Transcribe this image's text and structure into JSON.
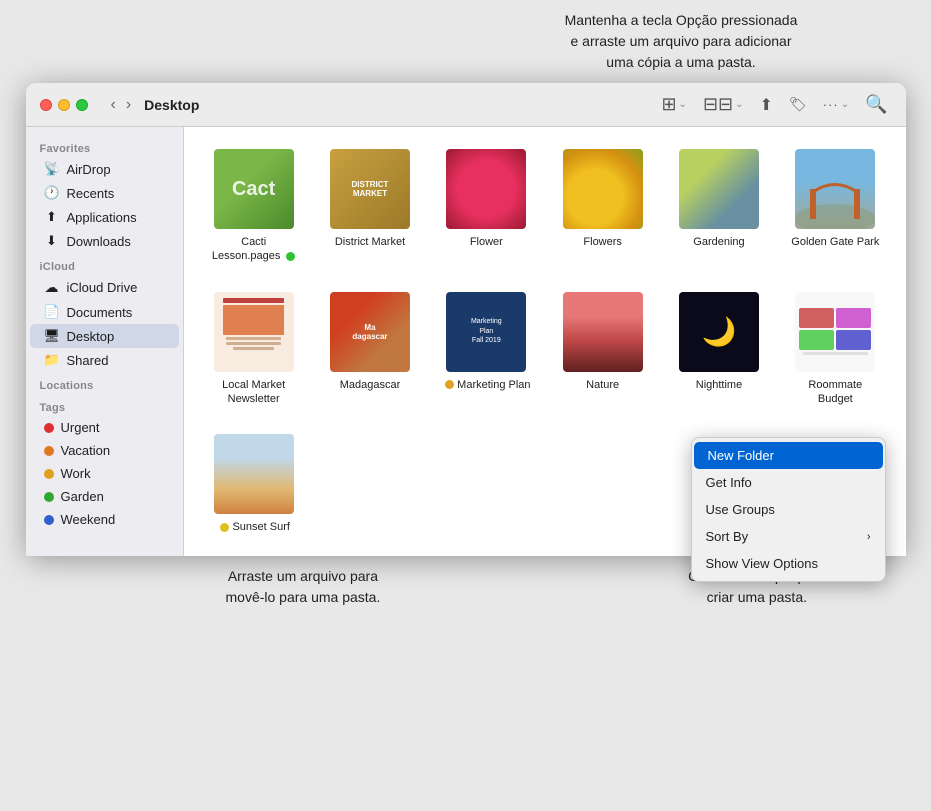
{
  "tooltip_top": "Mantenha a tecla Opção pressionada\ne arraste um arquivo para adicionar\numa cópia a uma pasta.",
  "window": {
    "title": "Desktop"
  },
  "toolbar": {
    "back": "‹",
    "forward": "›",
    "view_icon": "⊞",
    "group_icon": "⊟",
    "share_icon": "↑",
    "tag_icon": "🏷",
    "more_icon": "···",
    "search_icon": "🔍"
  },
  "sidebar": {
    "favorites": [
      {
        "id": "airdrop",
        "icon": "📡",
        "label": "AirDrop"
      },
      {
        "id": "recents",
        "icon": "🕐",
        "label": "Recents"
      },
      {
        "id": "applications",
        "icon": "⬆",
        "label": "Applications"
      },
      {
        "id": "downloads",
        "icon": "⬇",
        "label": "Downloads"
      }
    ],
    "icloud_label": "iCloud",
    "icloud": [
      {
        "id": "icloud-drive",
        "icon": "☁",
        "label": "iCloud Drive"
      },
      {
        "id": "documents",
        "icon": "📄",
        "label": "Documents"
      },
      {
        "id": "desktop",
        "icon": "🖥",
        "label": "Desktop",
        "active": true
      },
      {
        "id": "shared",
        "icon": "📁",
        "label": "Shared"
      }
    ],
    "locations_label": "Locations",
    "locations": [],
    "tags_label": "Tags",
    "tags": [
      {
        "id": "urgent",
        "color": "#e03030",
        "label": "Urgent"
      },
      {
        "id": "vacation",
        "color": "#e07820",
        "label": "Vacation"
      },
      {
        "id": "work",
        "color": "#e0a020",
        "label": "Work"
      },
      {
        "id": "garden",
        "color": "#30a830",
        "label": "Garden"
      },
      {
        "id": "weekend",
        "color": "#3060d0",
        "label": "Weekend"
      }
    ]
  },
  "files": [
    {
      "id": "cacti",
      "name": "Cacti\nLesson.pages",
      "thumb": "cacti",
      "badge": "#30c030",
      "badge_visible": true
    },
    {
      "id": "district",
      "name": "District Market",
      "thumb": "district",
      "badge": null
    },
    {
      "id": "flower",
      "name": "Flower",
      "thumb": "flower",
      "badge": null
    },
    {
      "id": "flowers",
      "name": "Flowers",
      "thumb": "flowers",
      "badge": null
    },
    {
      "id": "gardening",
      "name": "Gardening",
      "thumb": "gardening",
      "badge": null
    },
    {
      "id": "goldengate",
      "name": "Golden Gate Park",
      "thumb": "goldengate",
      "badge": null
    },
    {
      "id": "newsletter",
      "name": "Local Market\nNewsletter",
      "thumb": "newsletter",
      "badge": null
    },
    {
      "id": "madagascar",
      "name": "Madagascar",
      "thumb": "madagascar",
      "badge": null
    },
    {
      "id": "marketing",
      "name": "Marketing Plan",
      "thumb": "marketing",
      "badge": "#e0a020",
      "badge_visible": true
    },
    {
      "id": "nature",
      "name": "Nature",
      "thumb": "nature",
      "badge": null
    },
    {
      "id": "nighttime",
      "name": "Nighttime",
      "thumb": "nighttime",
      "badge": null
    },
    {
      "id": "budget",
      "name": "Roommate\nBudget",
      "thumb": "budget",
      "badge": null
    },
    {
      "id": "sunset",
      "name": "Sunset Surf",
      "thumb": "sunset",
      "badge": "#e0c020",
      "badge_visible": true
    }
  ],
  "context_menu": {
    "items": [
      {
        "id": "new-folder",
        "label": "New Folder",
        "highlighted": true,
        "has_submenu": false
      },
      {
        "id": "get-info",
        "label": "Get Info",
        "highlighted": false,
        "has_submenu": false
      },
      {
        "id": "use-groups",
        "label": "Use Groups",
        "highlighted": false,
        "has_submenu": false
      },
      {
        "id": "sort-by",
        "label": "Sort By",
        "highlighted": false,
        "has_submenu": true
      },
      {
        "id": "show-view-options",
        "label": "Show View Options",
        "highlighted": false,
        "has_submenu": false
      }
    ]
  },
  "annotations": {
    "bottom_left": "Arraste um arquivo para\nmovê-lo para uma pasta.",
    "bottom_right": "Controle + clique para\ncriar uma pasta."
  }
}
